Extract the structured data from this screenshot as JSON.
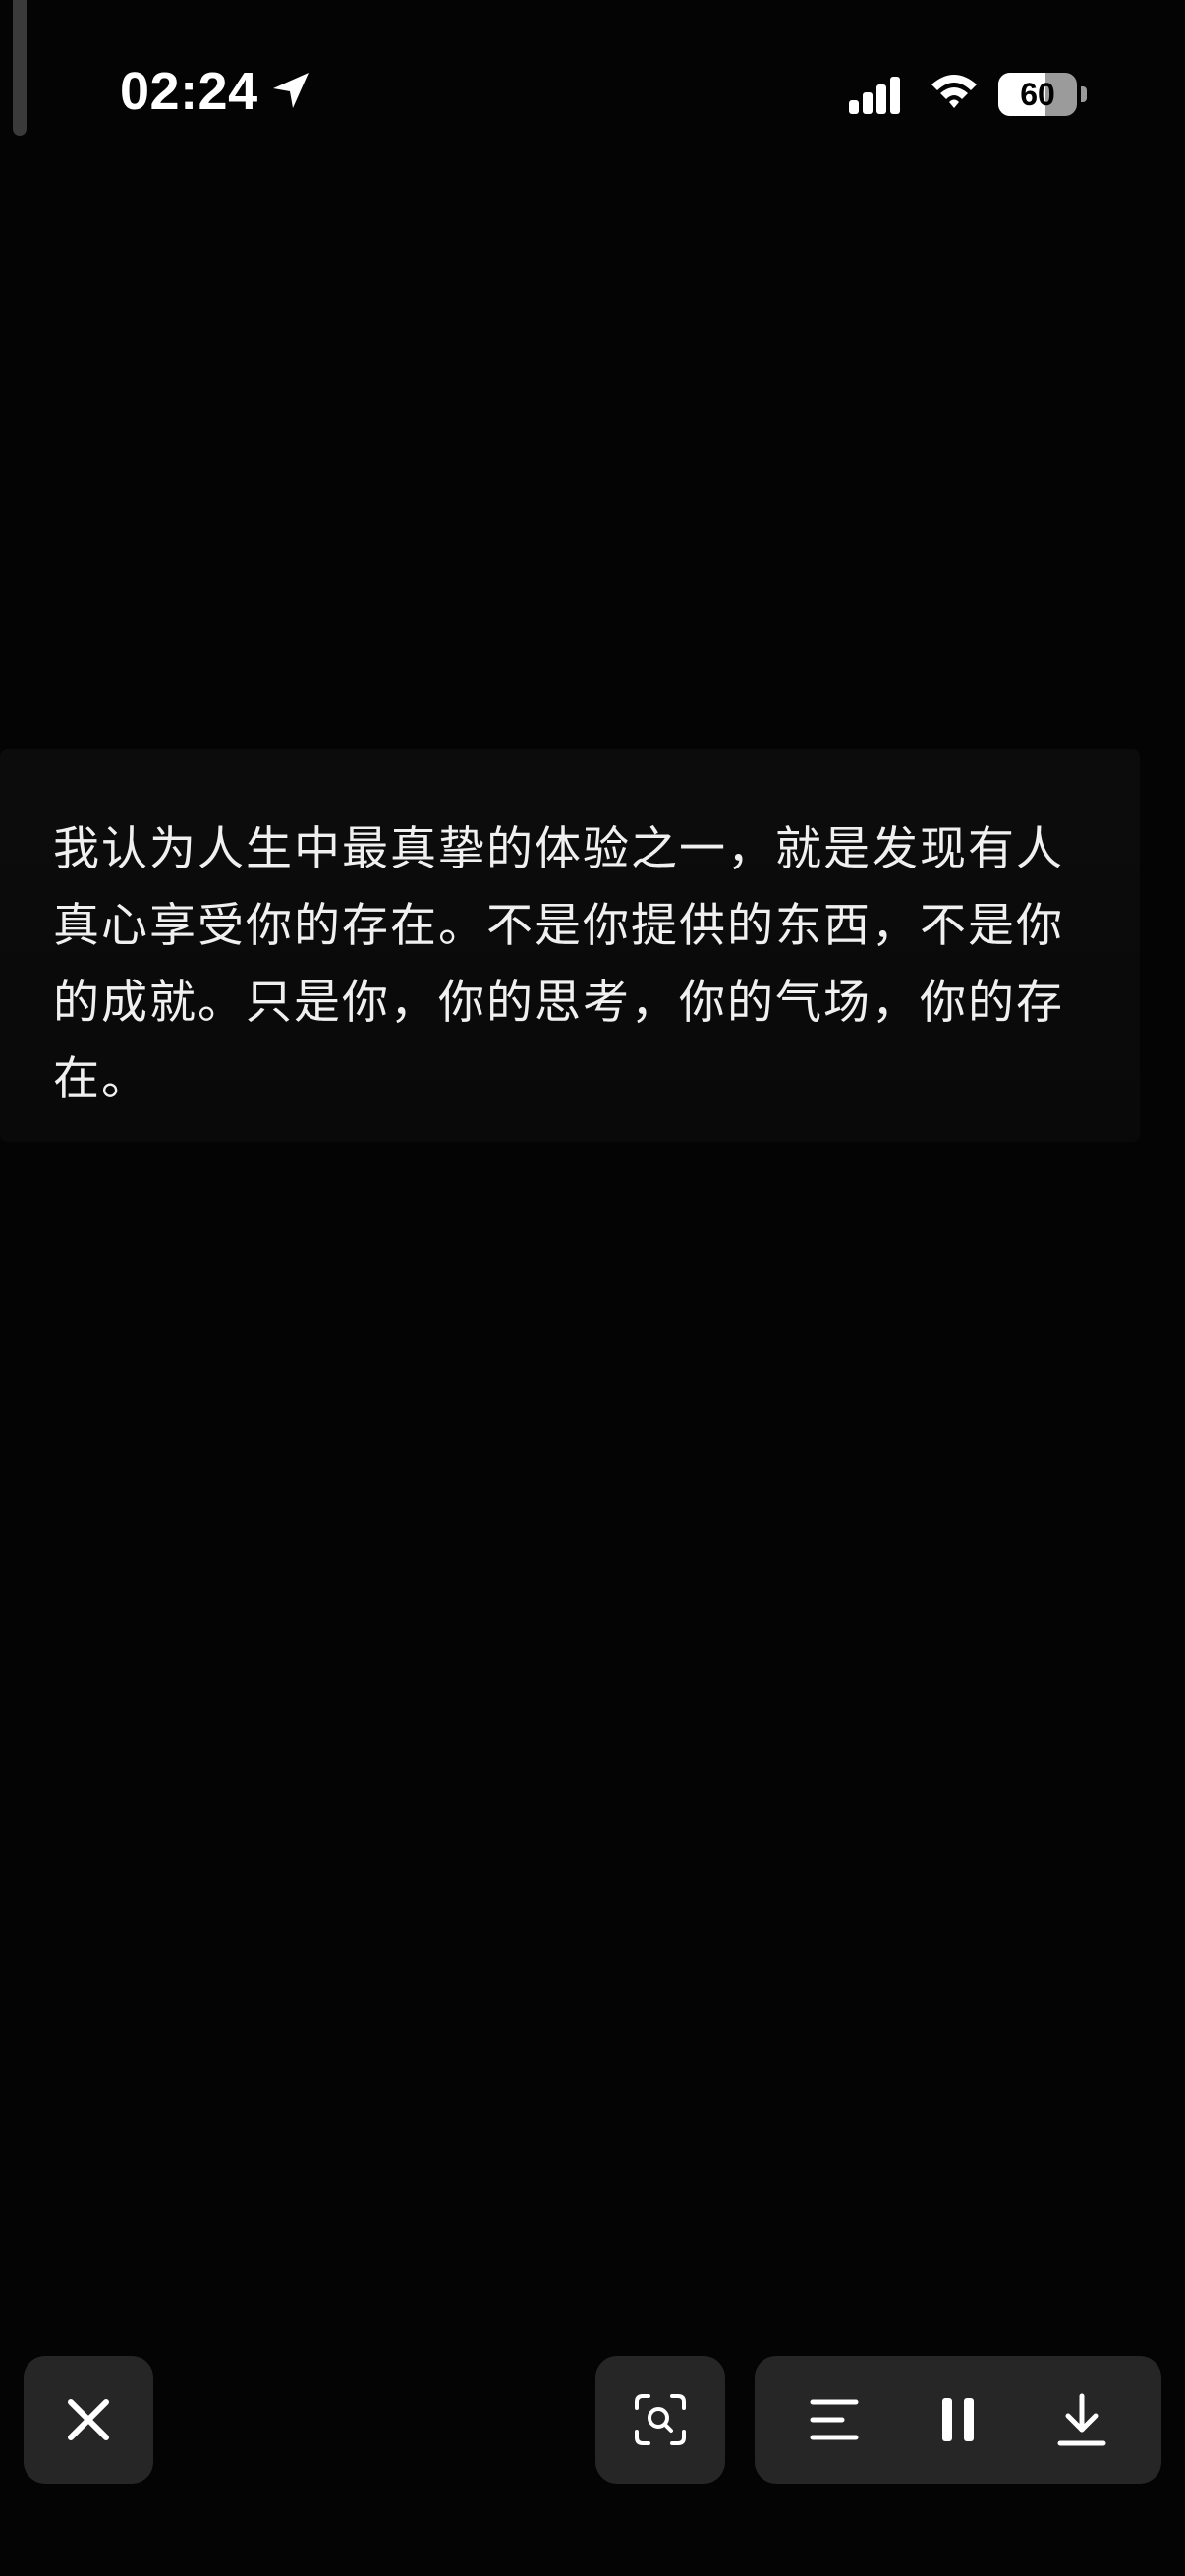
{
  "status_bar": {
    "time": "02:24",
    "battery_level": "60",
    "battery_fraction": 0.6,
    "icons": [
      "location-arrow-icon",
      "cellular-signal-icon",
      "wifi-icon",
      "battery-icon"
    ]
  },
  "quote": {
    "text": "我认为人生中最真挚的体验之一，就是发现有人真心享受你的存在。不是你提供的东西，不是你的成就。只是你，你的思考，你的气场，你的存在。"
  },
  "controls": {
    "close_icon": "close-icon",
    "scan_icon": "scan-search-icon",
    "text_align_icon": "text-align-icon",
    "pause_icon": "pause-icon",
    "download_icon": "download-icon"
  },
  "colors": {
    "background": "#040404",
    "button": "#262626",
    "text": "#f0f0f0"
  }
}
